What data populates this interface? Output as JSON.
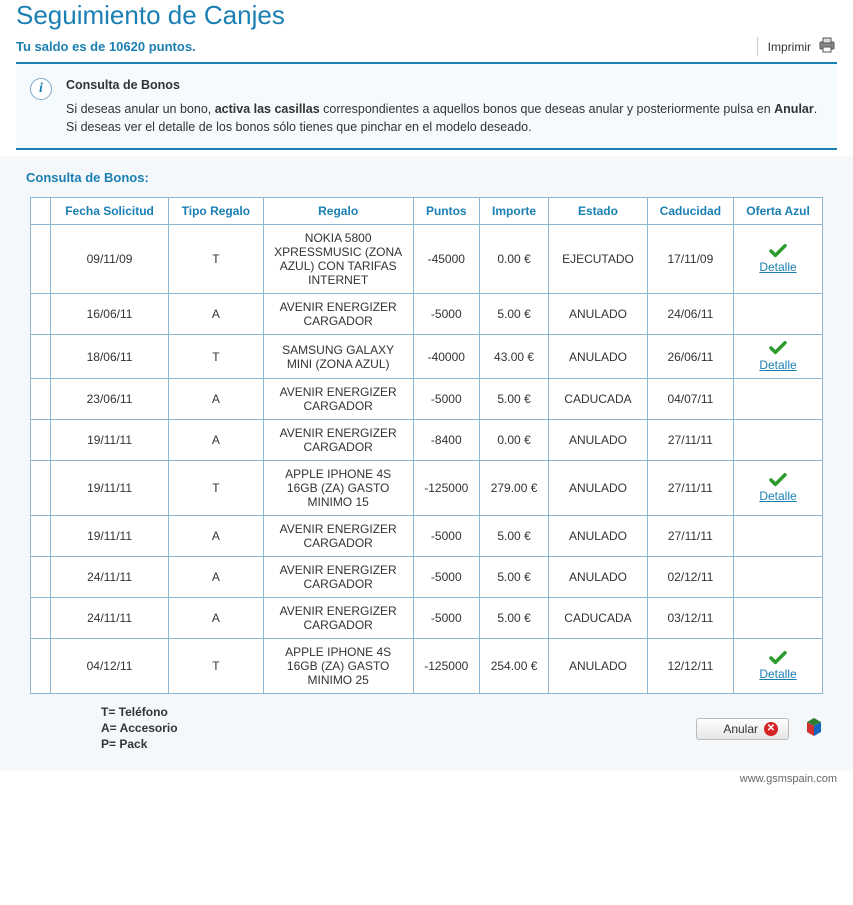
{
  "header": {
    "title": "Seguimiento de Canjes",
    "saldo_prefix": "Tu saldo es de ",
    "saldo_value": "10620",
    "saldo_suffix": " puntos.",
    "print_label": "Imprimir"
  },
  "info": {
    "title": "Consulta de Bonos",
    "line1_a": "Si deseas anular un bono, ",
    "line1_b": "activa las casillas",
    "line1_c": " correspondientes a aquellos bonos que deseas anular y posteriormente pulsa en ",
    "line1_d": "Anular",
    "line1_e": ".",
    "line2": "Si deseas ver el detalle de los bonos sólo tienes que pinchar en el modelo deseado."
  },
  "section": {
    "title": "Consulta de Bonos:"
  },
  "table": {
    "headers": {
      "check": "",
      "fecha": "Fecha Solicitud",
      "tipo": "Tipo Regalo",
      "regalo": "Regalo",
      "puntos": "Puntos",
      "importe": "Importe",
      "estado": "Estado",
      "caducidad": "Caducidad",
      "oferta": "Oferta Azul"
    },
    "detalle_label": "Detalle",
    "rows": [
      {
        "fecha": "09/11/09",
        "tipo": "T",
        "regalo": "NOKIA 5800 XPRESSMUSIC (ZONA AZUL) CON TARIFAS INTERNET",
        "puntos": "-45000",
        "importe": "0.00 €",
        "estado": "EJECUTADO",
        "caducidad": "17/11/09",
        "detalle": true
      },
      {
        "fecha": "16/06/11",
        "tipo": "A",
        "regalo": "AVENIR ENERGIZER CARGADOR",
        "puntos": "-5000",
        "importe": "5.00 €",
        "estado": "ANULADO",
        "caducidad": "24/06/11",
        "detalle": false
      },
      {
        "fecha": "18/06/11",
        "tipo": "T",
        "regalo": "SAMSUNG GALAXY MINI (ZONA AZUL)",
        "puntos": "-40000",
        "importe": "43.00 €",
        "estado": "ANULADO",
        "caducidad": "26/06/11",
        "detalle": true
      },
      {
        "fecha": "23/06/11",
        "tipo": "A",
        "regalo": "AVENIR ENERGIZER CARGADOR",
        "puntos": "-5000",
        "importe": "5.00 €",
        "estado": "CADUCADA",
        "caducidad": "04/07/11",
        "detalle": false
      },
      {
        "fecha": "19/11/11",
        "tipo": "A",
        "regalo": "AVENIR ENERGIZER CARGADOR",
        "puntos": "-8400",
        "importe": "0.00 €",
        "estado": "ANULADO",
        "caducidad": "27/11/11",
        "detalle": false
      },
      {
        "fecha": "19/11/11",
        "tipo": "T",
        "regalo": "APPLE IPHONE 4S 16GB (ZA) GASTO MINIMO 15",
        "puntos": "-125000",
        "importe": "279.00 €",
        "estado": "ANULADO",
        "caducidad": "27/11/11",
        "detalle": true
      },
      {
        "fecha": "19/11/11",
        "tipo": "A",
        "regalo": "AVENIR ENERGIZER CARGADOR",
        "puntos": "-5000",
        "importe": "5.00 €",
        "estado": "ANULADO",
        "caducidad": "27/11/11",
        "detalle": false
      },
      {
        "fecha": "24/11/11",
        "tipo": "A",
        "regalo": "AVENIR ENERGIZER CARGADOR",
        "puntos": "-5000",
        "importe": "5.00 €",
        "estado": "ANULADO",
        "caducidad": "02/12/11",
        "detalle": false
      },
      {
        "fecha": "24/11/11",
        "tipo": "A",
        "regalo": "AVENIR ENERGIZER CARGADOR",
        "puntos": "-5000",
        "importe": "5.00 €",
        "estado": "CADUCADA",
        "caducidad": "03/12/11",
        "detalle": false
      },
      {
        "fecha": "04/12/11",
        "tipo": "T",
        "regalo": "APPLE IPHONE 4S 16GB (ZA) GASTO MINIMO 25",
        "puntos": "-125000",
        "importe": "254.00 €",
        "estado": "ANULADO",
        "caducidad": "12/12/11",
        "detalle": true
      }
    ]
  },
  "legend": {
    "t": "T= Teléfono",
    "a": "A= Accesorio",
    "p": "P= Pack"
  },
  "footer": {
    "anular_label": "Anular",
    "watermark": "www.gsmspain.com"
  }
}
